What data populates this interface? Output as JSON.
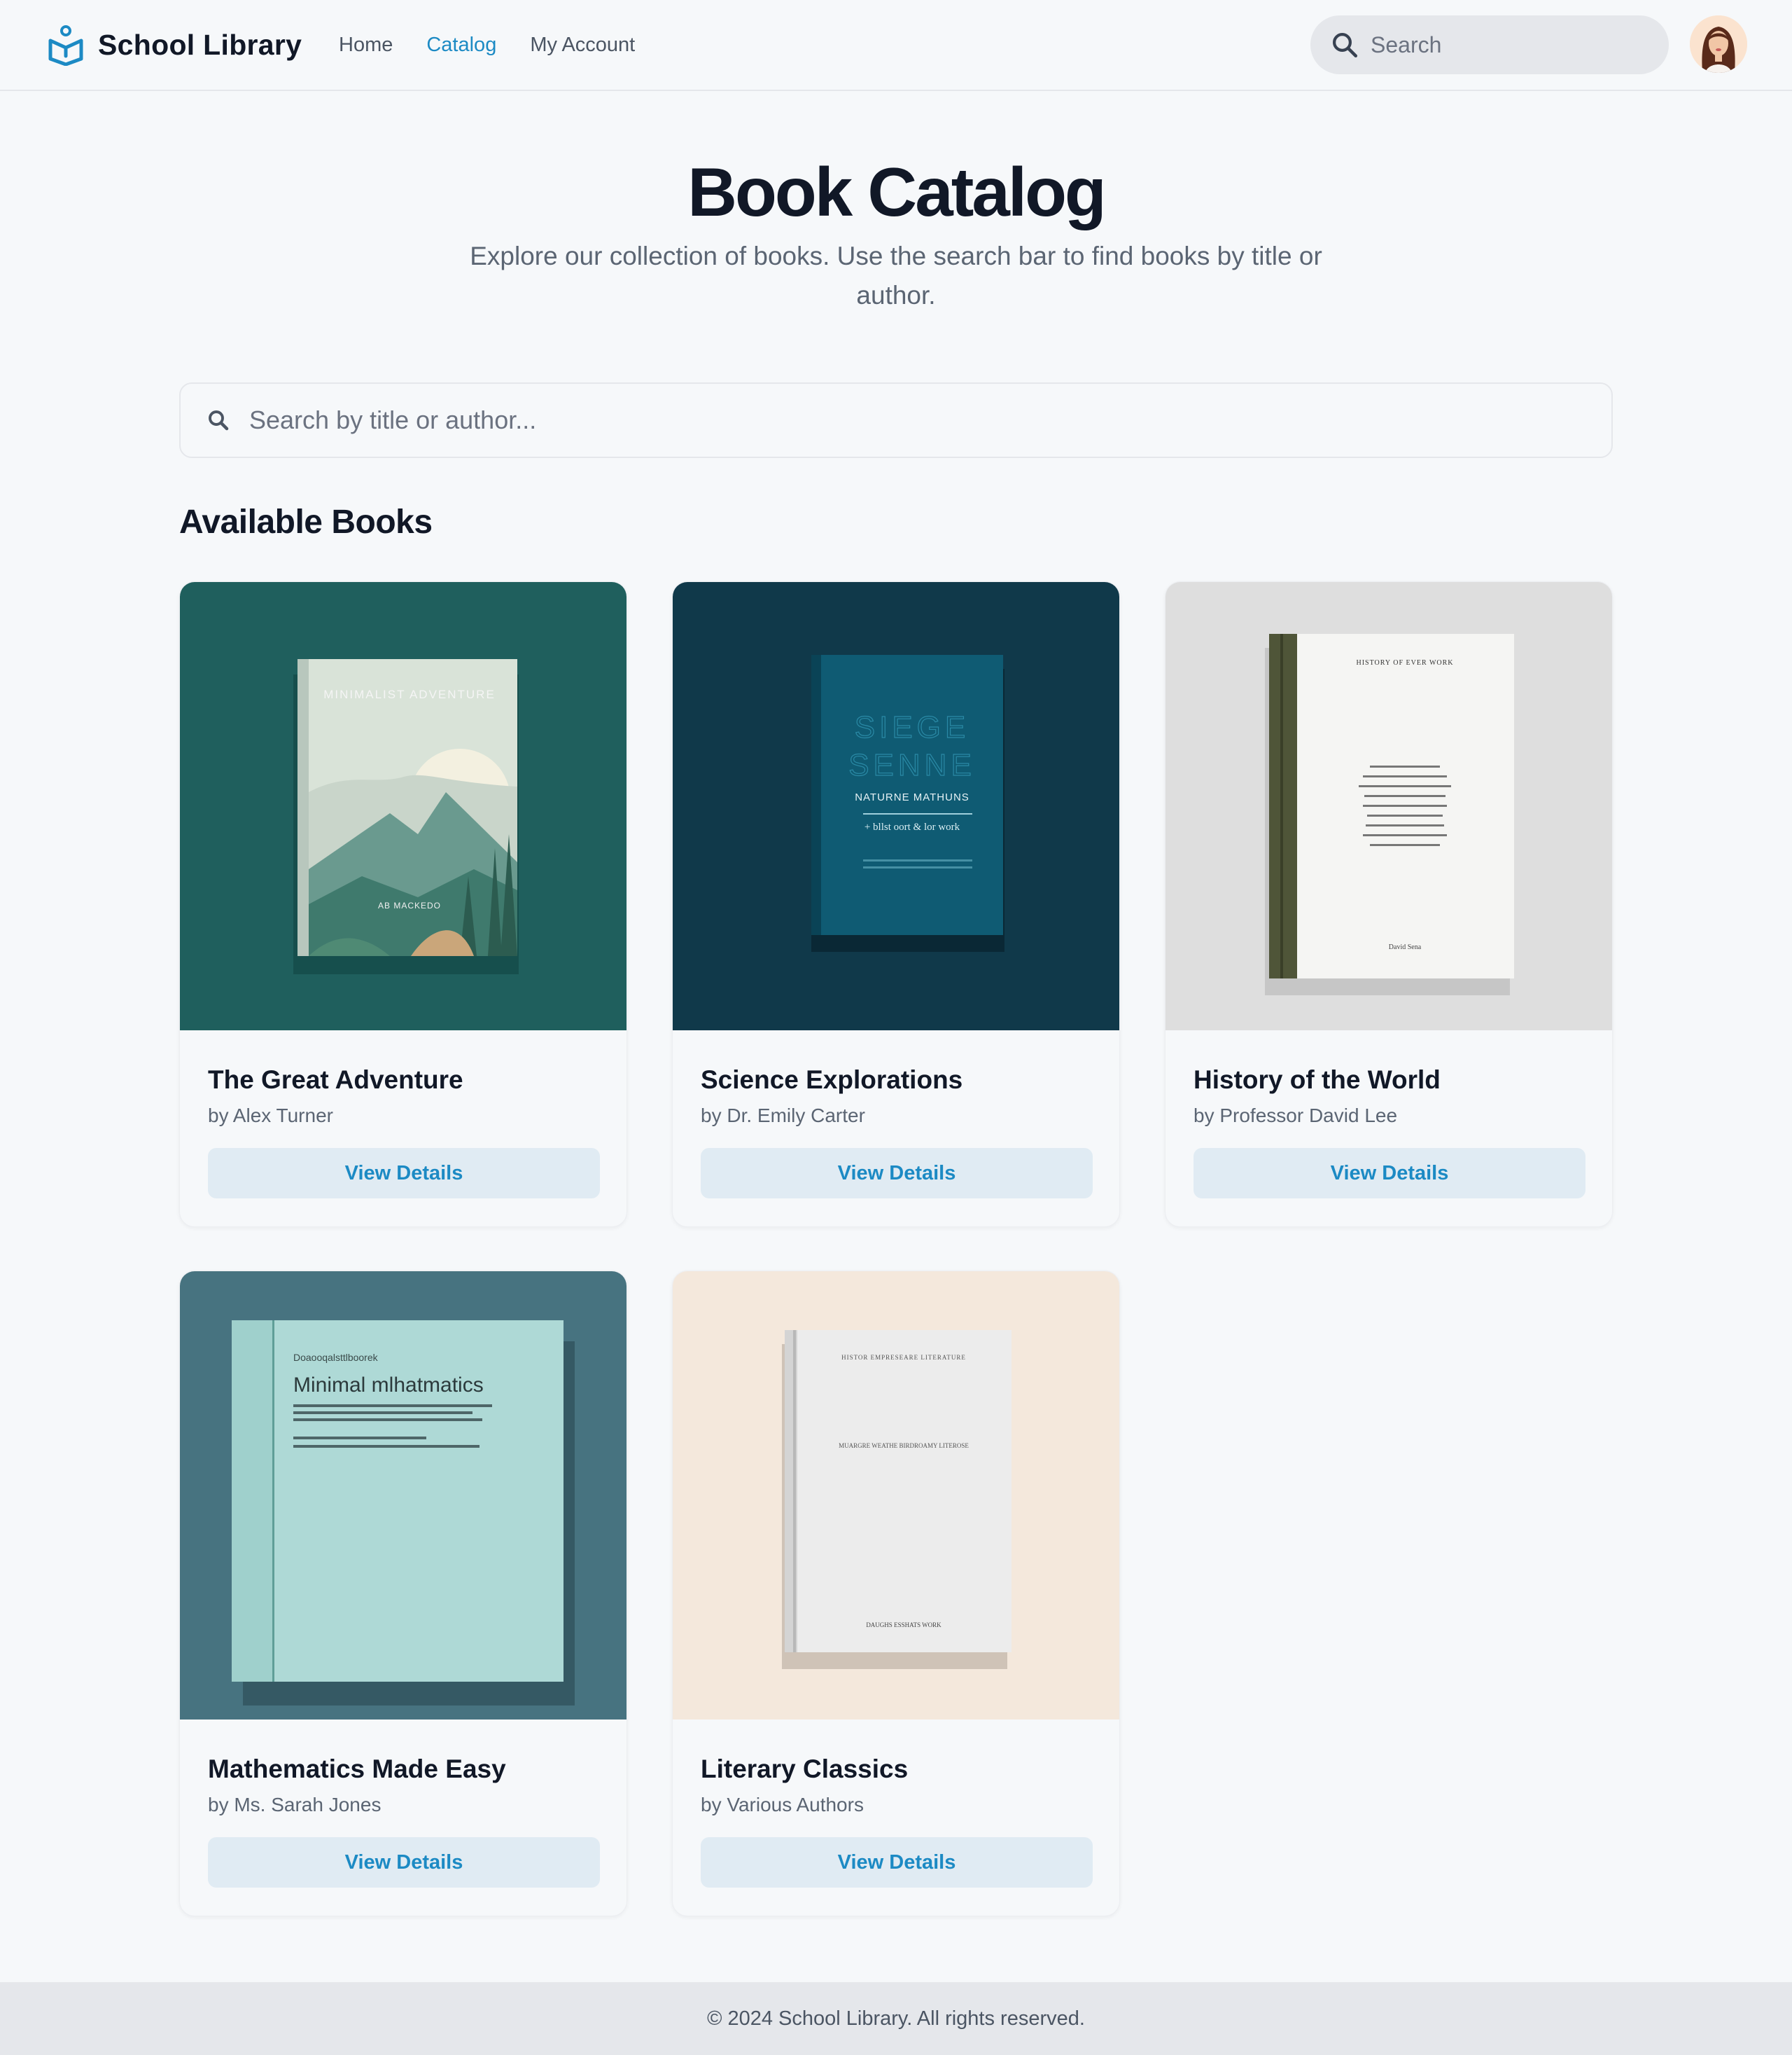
{
  "app": {
    "name": "School Library",
    "accent": "#1c8ac4",
    "logo_icon": "library-book-icon"
  },
  "nav": {
    "items": [
      {
        "label": "Home",
        "active": false
      },
      {
        "label": "Catalog",
        "active": true
      },
      {
        "label": "My Account",
        "active": false
      }
    ]
  },
  "header_search": {
    "placeholder": "Search",
    "icon": "search-icon"
  },
  "user": {
    "avatar": "user-avatar"
  },
  "hero": {
    "title": "Book Catalog",
    "subtitle": "Explore our collection of books. Use the search bar to find books by title or author."
  },
  "catalog_search": {
    "placeholder": "Search by title or author...",
    "icon": "search-icon"
  },
  "section": {
    "title": "Available Books"
  },
  "books": [
    {
      "title": "The Great Adventure",
      "author": "by Alex Turner",
      "button": "View Details",
      "cover": {
        "background": "#1f5f5d",
        "book_color": "#d9e3d8",
        "cover_text": "MINIMALIST ADVENTURE",
        "cover_footer": "AB MACKEDO"
      }
    },
    {
      "title": "Science Explorations",
      "author": "by Dr. Emily Carter",
      "button": "View Details",
      "cover": {
        "background": "#10394a",
        "book_color": "#0f5b73",
        "cover_text_1": "SIEGE",
        "cover_text_2": "SENNE",
        "cover_text_3": "NATURNE MATHUNS",
        "cover_text_4": "+ bllst oort & lor work"
      }
    },
    {
      "title": "History of the World",
      "author": "by Professor David Lee",
      "button": "View Details",
      "cover": {
        "background": "#dedede",
        "book_color": "#f5f5f3",
        "spine_color": "#4f5538",
        "cover_text": "HISTORY OF EVER WORK",
        "cover_footer": "David Sena"
      }
    },
    {
      "title": "Mathematics Made Easy",
      "author": "by Ms. Sarah Jones",
      "button": "View Details",
      "cover": {
        "background": "#477380",
        "book_color": "#aed9d6",
        "cover_kicker": "Doaooqalsttlboorek",
        "cover_text": "Minimal mlhatmatics"
      }
    },
    {
      "title": "Literary Classics",
      "author": "by Various Authors",
      "button": "View Details",
      "cover": {
        "background": "#f4e8dc",
        "book_color": "#ececec",
        "cover_text_top": "HISTOR EMPRESEARE LITERATURE",
        "cover_text_mid": "MUARGRE WEATHE BIRDROAMY LITEROSE",
        "cover_footer": "DAUGHS ESSHATS WORK"
      }
    }
  ],
  "footer": {
    "text": "© 2024 School Library. All rights reserved."
  }
}
